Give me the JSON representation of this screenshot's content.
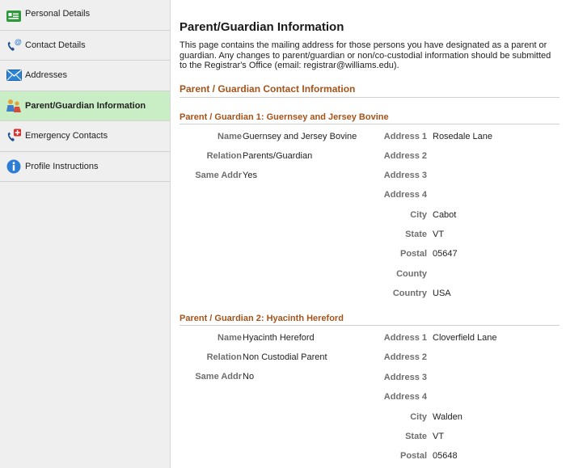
{
  "sidebar": {
    "items": [
      {
        "label": "Personal Details",
        "icon": "id-card-icon"
      },
      {
        "label": "Contact Details",
        "icon": "phone-at-icon"
      },
      {
        "label": "Addresses",
        "icon": "envelope-icon"
      },
      {
        "label": "Parent/Guardian Information",
        "icon": "people-icon"
      },
      {
        "label": "Emergency Contacts",
        "icon": "phone-plus-icon"
      },
      {
        "label": "Profile Instructions",
        "icon": "info-icon"
      }
    ],
    "active_index": 3
  },
  "main": {
    "title": "Parent/Guardian Information",
    "intro": "This page contains the mailing address for those persons you have designated as a parent or guardian. Any changes to parent/guardian or non/co-custodial information should be submitted to the Registrar's Office (email: registrar@williams.edu).",
    "section_heading": "Parent / Guardian Contact Information",
    "labels": {
      "name": "Name",
      "relation": "Relation",
      "same_addr": "Same Addr",
      "address1": "Address 1",
      "address2": "Address 2",
      "address3": "Address 3",
      "address4": "Address 4",
      "city": "City",
      "state": "State",
      "postal": "Postal",
      "county": "County",
      "country": "Country"
    },
    "guardians": [
      {
        "heading": "Parent / Guardian 1: Guernsey and Jersey Bovine",
        "name": "Guernsey and Jersey Bovine",
        "relation": "Parents/Guardian",
        "same_addr": "Yes",
        "address1": "Rosedale Lane",
        "address2": "",
        "address3": "",
        "address4": "",
        "city": "Cabot",
        "state": "VT",
        "postal": "05647",
        "county": "",
        "country": "USA"
      },
      {
        "heading": "Parent / Guardian 2: Hyacinth Hereford",
        "name": "Hyacinth Hereford",
        "relation": "Non Custodial Parent",
        "same_addr": "No",
        "address1": "Cloverfield Lane",
        "address2": "",
        "address3": "",
        "address4": "",
        "city": "Walden",
        "state": "VT",
        "postal": "05648"
      }
    ]
  },
  "colors": {
    "sidebar_bg": "#efefef",
    "active_bg": "#c9eec5",
    "heading_orange": "#a4531a",
    "label_gray": "#6e6e6e"
  }
}
